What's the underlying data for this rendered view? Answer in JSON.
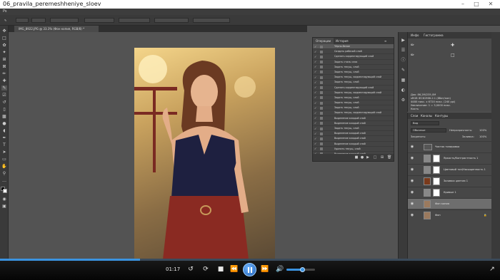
{
  "player": {
    "title": "06_pravila_peremeshheniye_sloev",
    "time": "01:17",
    "progress": 0.28,
    "volume": 0.55,
    "icons": [
      "minimize-icon",
      "restore-icon",
      "close-icon",
      "rewind-icon",
      "stop-icon",
      "play-pause-icon",
      "forward-icon",
      "volume-icon",
      "fullscreen-icon"
    ]
  },
  "photoshop": {
    "document_tab": "IMG_8922.JPG @ 33.3% (Фон копия, RGB/8) *",
    "history_panel": {
      "tabs": [
        "Операции",
        "История"
      ],
      "steps": [
        "Чёрно-белое",
        "Создать рабочий слой",
        "Сделать корректирующий слой",
        "Задать стиль слоя",
        "Задать текущ. слой",
        "Задать текущ. слой",
        "Задать текущ. корректирующий слой",
        "Задать текущ. слой",
        "Сделать корректирующий слой",
        "Задать текущ. корректирующий слой",
        "Задать текущ. слой",
        "Задать текущ. слой",
        "Задать текущ. слой",
        "Задать текущ. корректирующий слой",
        "Выделение каждый слой",
        "Выделение каждый слой",
        "Задать текущ. слой",
        "Выделение каждый слой",
        "Выделение каждый слой",
        "Выделение каждый слой",
        "Удалить текущ. слой",
        "Выделение каждый слой"
      ]
    },
    "info_panel": {
      "tabs": [
        "Инфо",
        "Гистограмма"
      ],
      "lines": [
        "Док: 86,2M/235,0M",
        "sRGB IEC61966-2.1 (8бит/кан)",
        "4480 пикс. x 6720 пикс. (240 ppi)",
        "Увеличение: 1 = 3,0000 пикс.",
        "Кисть"
      ]
    },
    "layers_panel": {
      "tabs": [
        "Слои",
        "Каналы",
        "Контуры"
      ],
      "filter_label": "Вид",
      "blend_mode": "Обычные",
      "opacity_label": "Непрозрачность:",
      "opacity": "100%",
      "fill_label": "Заливка:",
      "fill": "100%",
      "lock_label": "Закрепить:",
      "layers": [
        {
          "name": "Чистая тонировка",
          "type": "group"
        },
        {
          "name": "Яркость/Контрастность 1",
          "type": "adjustment"
        },
        {
          "name": "Цветовой тон/Насыщенность 1",
          "type": "adjustment"
        },
        {
          "name": "Заливка цветом 1",
          "type": "fill"
        },
        {
          "name": "Кривые 1",
          "type": "adjustment"
        },
        {
          "name": "Фон копия",
          "type": "pixel",
          "selected": true
        },
        {
          "name": "Фон",
          "type": "pixel",
          "locked": true
        }
      ]
    }
  },
  "colors": {
    "accent": "#3a93e0",
    "ps_bg": "#535353",
    "panel_bg": "#474747"
  }
}
